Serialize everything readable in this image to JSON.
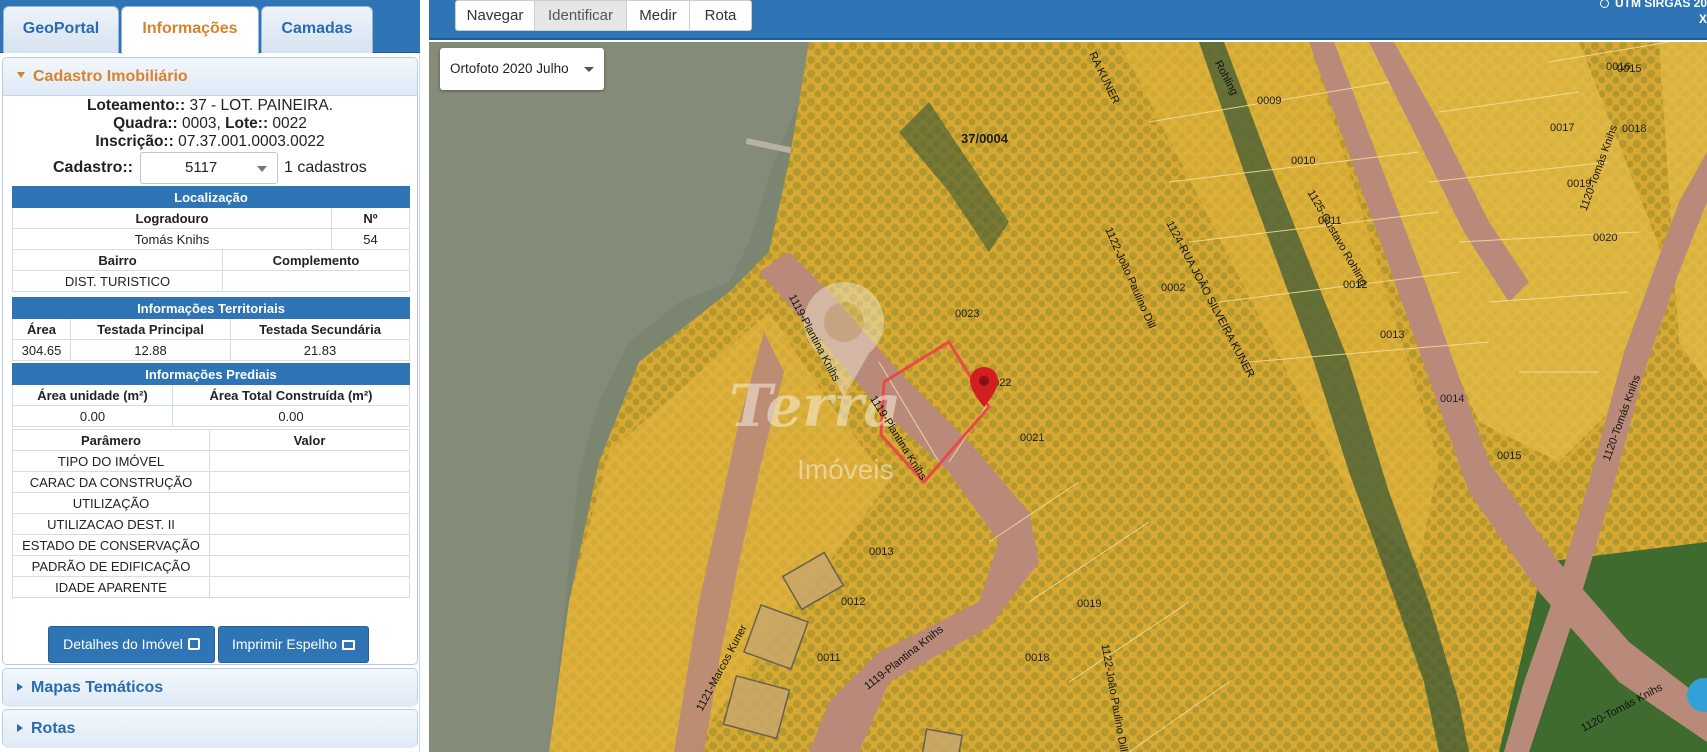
{
  "tabs": [
    {
      "label": "GeoPortal",
      "active": false
    },
    {
      "label": "Informações",
      "active": true
    },
    {
      "label": "Camadas",
      "active": false
    }
  ],
  "cadastro_section": {
    "title": "Cadastro Imobiliário"
  },
  "header_info": {
    "loteamento_label": "Loteamento::",
    "loteamento_value": " 37 - LOT. PAINEIRA.",
    "quadra_label": "Quadra::",
    "quadra_value": " 0003, ",
    "lote_label": "Lote::",
    "lote_value": " 0022",
    "inscricao_label": "Inscrição::",
    "inscricao_value": " 07.37.001.0003.0022",
    "cadastro_label": "Cadastro::",
    "cadastro_value": "5117",
    "cadastro_count": "1 cadastros"
  },
  "localizacao": {
    "title": "Localização",
    "col_logradouro": "Logradouro",
    "col_numero": "Nº",
    "logradouro": "Tomás Knihs",
    "numero": "54",
    "col_bairro": "Bairro",
    "col_complemento": "Complemento",
    "bairro": "DIST. TURISTICO",
    "complemento": ""
  },
  "territoriais": {
    "title": "Informações Territoriais",
    "col_area": "Área",
    "col_testada_principal": "Testada Principal",
    "col_testada_secundaria": "Testada Secundária",
    "area": "304.65",
    "testada_principal": "12.88",
    "testada_secundaria": "21.83"
  },
  "prediais": {
    "title": "Informações Prediais",
    "col_area_unidade": "Área unidade (m²)",
    "col_area_total": "Área Total Construída (m²)",
    "area_unidade": "0.00",
    "area_total": "0.00",
    "col_parametro": "Parâmero",
    "col_valor": "Valor",
    "params": [
      {
        "name": "TIPO DO IMÓVEL",
        "value": ""
      },
      {
        "name": "CARAC DA CONSTRUÇÃO",
        "value": ""
      },
      {
        "name": "UTILIZAÇÃO",
        "value": ""
      },
      {
        "name": "UTILIZACAO DEST. II",
        "value": ""
      },
      {
        "name": "ESTADO DE CONSERVAÇÃO",
        "value": ""
      },
      {
        "name": "PADRÃO DE EDIFICAÇÃO",
        "value": ""
      },
      {
        "name": "IDADE APARENTE",
        "value": ""
      }
    ]
  },
  "buttons": {
    "detalhes": "Detalhes do Imóvel",
    "imprimir": "Imprimir Espelho"
  },
  "accordions": {
    "mapas": "Mapas Temáticos",
    "rotas": "Rotas"
  },
  "toolbar": {
    "navegar": "Navegar",
    "identificar": "Identificar",
    "medir": "Medir",
    "rota": "Rota",
    "utm_label": "UTM SIRGAS 20",
    "utm_x": "X"
  },
  "map": {
    "layer_select": "Ortofoto 2020 Julho",
    "block_label": "37/0004",
    "watermark_line1": "Terra",
    "watermark_line2": "Imóveis",
    "lot_labels": [
      "0009",
      "0010",
      "0011",
      "0012",
      "0013",
      "0014",
      "0015",
      "0016",
      "0017",
      "0018",
      "0019",
      "0020",
      "0002",
      "0023",
      "0022",
      "0021",
      "0019",
      "0018",
      "0013",
      "0012",
      "0011",
      "0015"
    ],
    "street_labels": [
      "1121-Marcos Kuner",
      "1119-Plantina Knihs",
      "1119-Plantina Knihs",
      "1119-Plantina Knihs",
      "1122-João Paulino Dill",
      "1122-João Paulino Dill",
      "1124-RUA JOÃO SILVEIRA KUNER",
      "1125-Gustavo Rohling",
      "1120-Tomás Knihs",
      "1120-Tomás Knihs",
      "1120-Tomás Knihs",
      "RA KUNER",
      "Rohling"
    ],
    "colors": {
      "lot_fill": "#e8b830",
      "street": "#b98a7a",
      "parcel_highlight": "#e84a4a",
      "pin": "#d11f1f",
      "water": "#7c8570"
    }
  }
}
